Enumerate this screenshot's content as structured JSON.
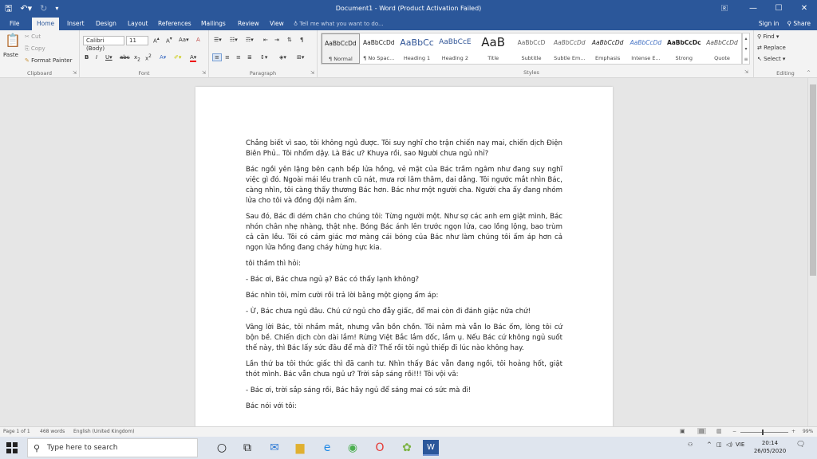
{
  "title_bar": {
    "title": "Document1 - Word (Product Activation Failed)",
    "controls": {
      "ribbon_options": "🅁",
      "minimize": "—",
      "maximize": "☐",
      "close": "✕"
    }
  },
  "tabs": [
    {
      "label": "File"
    },
    {
      "label": "Home"
    },
    {
      "label": "Insert"
    },
    {
      "label": "Design"
    },
    {
      "label": "Layout"
    },
    {
      "label": "References"
    },
    {
      "label": "Mailings"
    },
    {
      "label": "Review"
    },
    {
      "label": "View"
    }
  ],
  "tell_me": "Tell me what you want to do...",
  "account": {
    "sign_in": "Sign in",
    "share": "Share"
  },
  "ribbon": {
    "clipboard": {
      "paste": "Paste",
      "cut": "Cut",
      "copy": "Copy",
      "format_painter": "Format Painter",
      "label": "Clipboard"
    },
    "font": {
      "name": "Calibri (Body)",
      "size": "11",
      "label": "Font"
    },
    "paragraph": {
      "label": "Paragraph"
    },
    "styles": {
      "label": "Styles",
      "items": [
        {
          "preview": "AaBbCcDd",
          "name": "¶ Normal"
        },
        {
          "preview": "AaBbCcDd",
          "name": "¶ No Spac..."
        },
        {
          "preview": "AaBbCc",
          "name": "Heading 1"
        },
        {
          "preview": "AaBbCcE",
          "name": "Heading 2"
        },
        {
          "preview": "AaB",
          "name": "Title"
        },
        {
          "preview": "AaBbCcD",
          "name": "Subtitle"
        },
        {
          "preview": "AaBbCcDd",
          "name": "Subtle Em..."
        },
        {
          "preview": "AaBbCcDd",
          "name": "Emphasis"
        },
        {
          "preview": "AaBbCcDd",
          "name": "Intense E..."
        },
        {
          "preview": "AaBbCcDc",
          "name": "Strong"
        },
        {
          "preview": "AaBbCcDd",
          "name": "Quote"
        }
      ]
    },
    "editing": {
      "find": "Find",
      "replace": "Replace",
      "select": "Select",
      "label": "Editing"
    }
  },
  "document": {
    "paragraphs": [
      "Chẳng biết vì sao, tôi không ngủ được. Tôi suy nghĩ cho trận chiến nay mai, chiến dịch Điện Biên Phủ.. Tôi nhổm dậy. Là Bác ư? Khuya rồi, sao Người chưa ngủ nhỉ?",
      "Bác ngồi yên lặng bên cạnh bếp lửa hồng, vẻ mặt của Bác trầm ngâm như đang suy nghĩ việc gì đó. Ngoài mái lều tranh cũ nát, mưa rơi lâm thâm, dai dẳng. Tôi ngước mắt nhìn Bác, càng nhìn, tôi càng thấy thương Bác hơn. Bác như một người cha. Người cha ấy đang nhóm lửa cho tôi và đồng đội nằm ấm.",
      "Sau đó, Bác đi dém chăn cho chúng tôi: Từng người một. Như sợ các anh em giật mình, Bác nhón chân nhẹ nhàng, thật nhẹ. Bóng Bác ánh lên trước ngọn lửa, cao lồng lộng, bao trùm cả căn lều. Tôi có cảm giác mơ màng cái bóng của Bác như làm chúng tôi ấm áp hơn cả ngọn lửa hồng đang cháy hừng hực kia.",
      "tôi thầm thì hỏi:",
      "- Bác ơi, Bác chưa ngủ ạ? Bác có thấy lạnh không?",
      "Bác nhìn tôi, mỉm cười rồi trả lời bằng một giọng ấm áp:",
      "- Ừ, Bác chưa ngủ đâu. Chú cứ ngủ cho đẫy giấc, để mai còn đi đánh giặc nữa chứ!",
      "Vâng lời Bác, tôi nhắm mắt, nhưng vẫn bồn chồn. Tôi nằm mà vẫn lo Bác ốm, lòng tôi cứ bộn bề. Chiến dịch còn dài lắm! Rừng Việt Bắc lắm dốc, lắm ụ. Nếu Bác cứ không ngủ suốt thế này, thì Bác lấy sức đâu để mà đi? Thế rồi tôi ngủ thiếp đi lúc nào không hay.",
      "Lần thứ ba tôi thức giấc thì đã canh tư. Nhìn thấy Bác vẫn đang ngồi, tôi hoảng hốt, giật thót mình. Bác vẫn chưa ngủ ư? Trời sắp sáng rồi!!! Tôi vội vã:",
      "- Bác ơi, trời sắp sáng rồi, Bác hãy ngủ để sáng mai có sức mà đi!",
      "Bác nói với tôi:"
    ]
  },
  "status_bar": {
    "page": "Page 1 of 1",
    "words": "468 words",
    "language": "English (United Kingdom)",
    "zoom": "99%"
  },
  "taskbar": {
    "search_placeholder": "Type here to search",
    "lang": "VIE",
    "time": "20:14",
    "date": "26/05/2020"
  },
  "colors": {
    "word_blue": "#2b579a"
  }
}
